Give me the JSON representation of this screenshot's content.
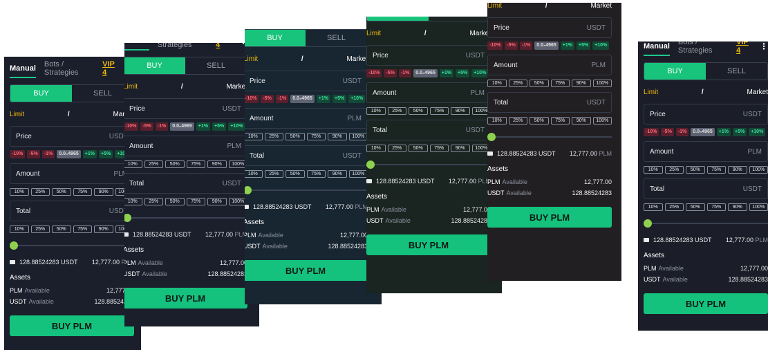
{
  "tabs": {
    "manual": "Manual",
    "bots": "Bots / Strategies"
  },
  "vip": "VIP 4",
  "more_glyph": "⋮",
  "side": {
    "buy": "BUY",
    "sell": "SELL"
  },
  "order_type": {
    "limit": "Limit",
    "slash": "/",
    "market": "Market"
  },
  "fields": {
    "price": {
      "label": "Price",
      "unit": "USDT"
    },
    "amount": {
      "label": "Amount",
      "unit": "PLM"
    },
    "total": {
      "label": "Total",
      "unit": "USDT"
    }
  },
  "price_chips": [
    "-10%",
    "-5%",
    "-1%",
    "0.0₅4965",
    "+1%",
    "+5%",
    "+10%"
  ],
  "percent_buttons": [
    "10%",
    "25%",
    "50%",
    "75%",
    "90%",
    "100%"
  ],
  "balance": {
    "usdt": "128.88524283 USDT",
    "plm_value": "12,777.00",
    "plm_unit": "PLM"
  },
  "assets_title": "Assets",
  "assets": [
    {
      "cur": "PLM",
      "label": "Available",
      "value": "12,777.00"
    },
    {
      "cur": "USDT",
      "label": "Available",
      "value": "128.88524283"
    }
  ],
  "buy_button": "BUY PLM",
  "colors": {
    "accent": "#18c47c",
    "vip": "#f0b90b",
    "neg": "#ff6a7a",
    "pos": "#3de3a1"
  }
}
